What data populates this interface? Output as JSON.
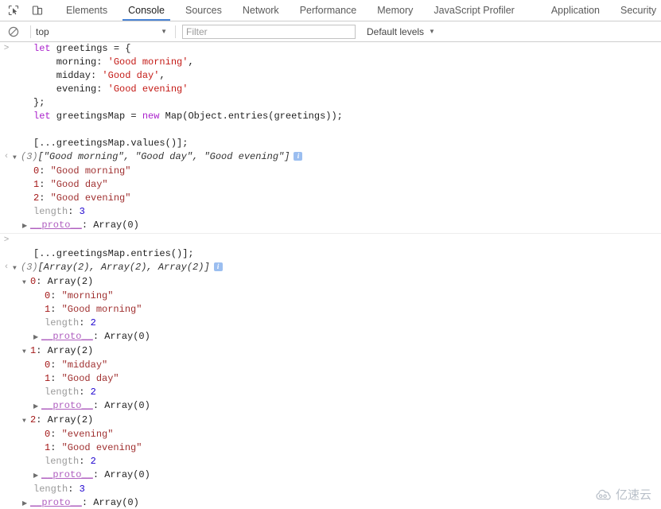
{
  "toolbar": {
    "inspect_icon": "inspect-cursor-icon",
    "device_icon": "device-toolbar-icon"
  },
  "tabs": [
    {
      "label": "Elements",
      "active": false
    },
    {
      "label": "Console",
      "active": true
    },
    {
      "label": "Sources",
      "active": false
    },
    {
      "label": "Network",
      "active": false
    },
    {
      "label": "Performance",
      "active": false
    },
    {
      "label": "Memory",
      "active": false
    },
    {
      "label": "JavaScript Profiler",
      "active": false
    },
    {
      "label": "Application",
      "active": false
    },
    {
      "label": "Security",
      "active": false
    }
  ],
  "filterbar": {
    "clear_icon": "clear-console-icon",
    "context": "top",
    "context_caret": "▼",
    "filter_placeholder": "Filter",
    "filter_value": "",
    "levels_label": "Default levels",
    "levels_caret": "▼"
  },
  "console": {
    "prompt_marker": ">",
    "output_marker": "‹",
    "entry1": {
      "code": {
        "l1_kw": "let",
        "l1_name": " greetings = {",
        "l2": "    morning: ",
        "l2_str": "'Good morning'",
        "l2_end": ",",
        "l3": "    midday: ",
        "l3_str": "'Good day'",
        "l3_end": ",",
        "l4": "    evening: ",
        "l4_str": "'Good evening'",
        "l5": "};",
        "l6_kw": "let",
        "l6_mid": " greetingsMap = ",
        "l6_kw2": "new",
        "l6_end": " Map(Object.entries(greetings));",
        "l8": "[...greetingsMap.values()];"
      },
      "result": {
        "count": "(3)",
        "preview": "[\"Good morning\", \"Good day\", \"Good evening\"]",
        "info_icon": "info-icon",
        "items": [
          {
            "key": "0",
            "value": "\"Good morning\""
          },
          {
            "key": "1",
            "value": "\"Good day\""
          },
          {
            "key": "2",
            "value": "\"Good evening\""
          }
        ],
        "length_key": "length",
        "length_value": "3",
        "proto_key": "__proto__",
        "proto_value": "Array(0)"
      }
    },
    "entry2": {
      "code": "[...greetingsMap.entries()];",
      "result": {
        "count": "(3)",
        "preview": "[Array(2), Array(2), Array(2)]",
        "info_icon": "info-icon",
        "groups": [
          {
            "key": "0",
            "type": "Array(2)",
            "items": [
              {
                "key": "0",
                "value": "\"morning\""
              },
              {
                "key": "1",
                "value": "\"Good morning\""
              }
            ],
            "length_key": "length",
            "length_value": "2",
            "proto_key": "__proto__",
            "proto_value": "Array(0)"
          },
          {
            "key": "1",
            "type": "Array(2)",
            "items": [
              {
                "key": "0",
                "value": "\"midday\""
              },
              {
                "key": "1",
                "value": "\"Good day\""
              }
            ],
            "length_key": "length",
            "length_value": "2",
            "proto_key": "__proto__",
            "proto_value": "Array(0)"
          },
          {
            "key": "2",
            "type": "Array(2)",
            "items": [
              {
                "key": "0",
                "value": "\"evening\""
              },
              {
                "key": "1",
                "value": "\"Good evening\""
              }
            ],
            "length_key": "length",
            "length_value": "2",
            "proto_key": "__proto__",
            "proto_value": "Array(0)"
          }
        ],
        "length_key": "length",
        "length_value": "3",
        "proto_key": "__proto__",
        "proto_value": "Array(0)"
      }
    }
  },
  "watermark": {
    "logo": "cloud-logo",
    "text": "亿速云"
  }
}
